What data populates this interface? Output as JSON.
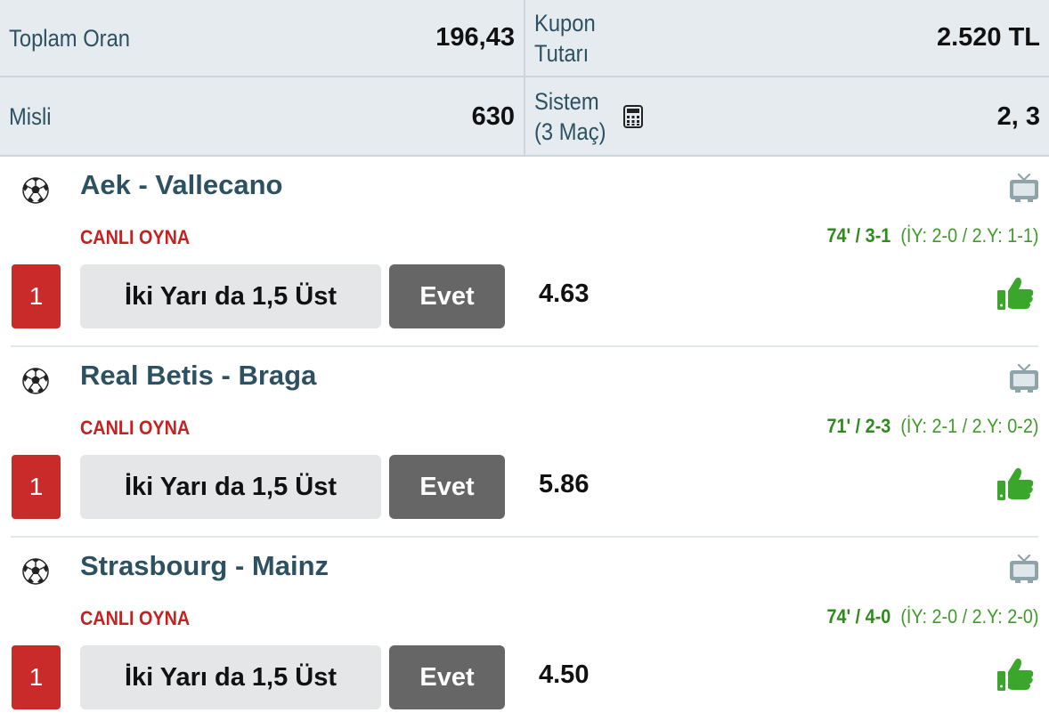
{
  "summary": {
    "total_odds_label": "Toplam Oran",
    "total_odds_value": "196,43",
    "coupon_amount_label_1": "Kupon",
    "coupon_amount_label_2": "Tutarı",
    "coupon_amount_value": "2.520 TL",
    "multiplier_label": "Misli",
    "multiplier_value": "630",
    "system_label_1": "Sistem",
    "system_label_2": "(3 Maç)",
    "system_value": "2, 3"
  },
  "matches": [
    {
      "title": "Aek - Vallecano",
      "live_label": "CANLI OYNA",
      "minute_score": "74' / 3-1",
      "half_scores": "(İY: 2-0 / 2.Y: 1-1)",
      "selection_number": "1",
      "market": "İki Yarı da 1,5 Üst",
      "pick": "Evet",
      "odd": "4.63"
    },
    {
      "title": "Real Betis - Braga",
      "live_label": "CANLI OYNA",
      "minute_score": "71' / 2-3",
      "half_scores": "(İY: 2-1 / 2.Y: 0-2)",
      "selection_number": "1",
      "market": "İki Yarı da 1,5 Üst",
      "pick": "Evet",
      "odd": "5.86"
    },
    {
      "title": "Strasbourg - Mainz",
      "live_label": "CANLI OYNA",
      "minute_score": "74' / 4-0",
      "half_scores": "(İY: 2-0 / 2.Y: 2-0)",
      "selection_number": "1",
      "market": "İki Yarı da 1,5 Üst",
      "pick": "Evet",
      "odd": "4.50"
    }
  ],
  "icons": {
    "sport": "soccer-ball-icon",
    "tv": "tv-icon",
    "like": "thumbs-up-icon",
    "calculator": "calculator-icon"
  },
  "colors": {
    "live_red": "#c42121",
    "score_green": "#3f9a2a",
    "selection_red": "#c92a2a",
    "pick_gray": "#666666",
    "summary_bg": "#e6ebef",
    "title_teal": "#2d5161"
  }
}
